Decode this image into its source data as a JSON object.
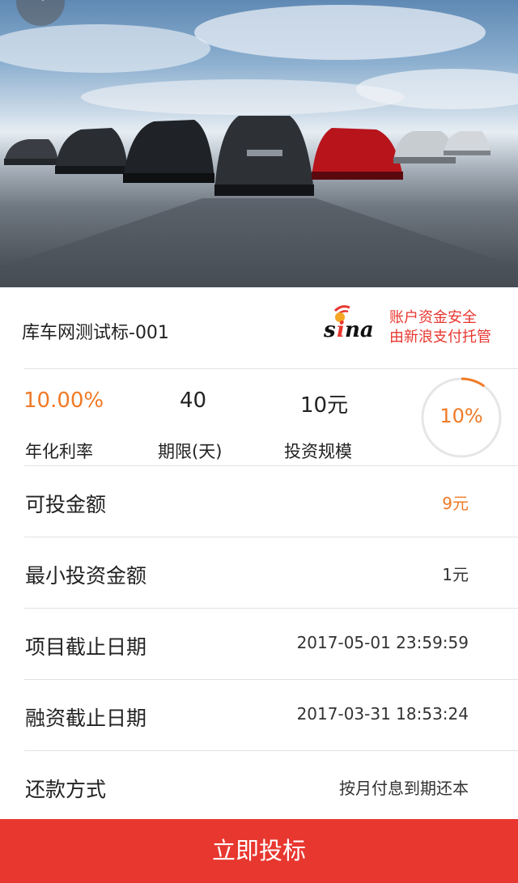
{
  "header": {
    "banner_alt": "cars banner"
  },
  "product": {
    "title": "库车网测试标-001"
  },
  "sina": {
    "logo_text": "sina",
    "security_line1": "账户资金安全",
    "security_line2": "由新浪支付托管"
  },
  "stats": {
    "rate_value": "10.00%",
    "rate_label": "年化利率",
    "term_value": "40",
    "term_label": "期限(天)",
    "scale_value": "10元",
    "scale_label": "投资规模",
    "progress_text": "10%",
    "progress_fraction": 0.1
  },
  "details": [
    {
      "label": "可投金额",
      "value": "9元"
    },
    {
      "label": "最小投资金额",
      "value": "1元"
    },
    {
      "label": "项目截止日期",
      "value": "2017-05-01 23:59:59"
    },
    {
      "label": "融资截止日期",
      "value": "2017-03-31 18:53:24"
    },
    {
      "label": "还款方式",
      "value": "按月付息到期还本"
    }
  ],
  "action": {
    "invest_label": "立即投标"
  },
  "colors": {
    "accent_orange": "#f07a26",
    "brand_red": "#e8372f"
  }
}
